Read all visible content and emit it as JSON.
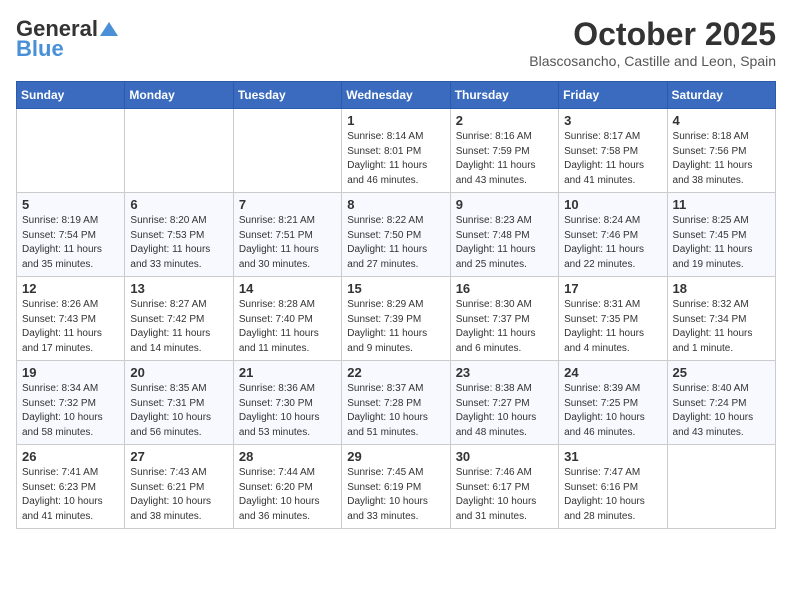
{
  "header": {
    "logo_general": "General",
    "logo_blue": "Blue",
    "month": "October 2025",
    "location": "Blascosancho, Castille and Leon, Spain"
  },
  "weekdays": [
    "Sunday",
    "Monday",
    "Tuesday",
    "Wednesday",
    "Thursday",
    "Friday",
    "Saturday"
  ],
  "weeks": [
    [
      {
        "day": "",
        "info": ""
      },
      {
        "day": "",
        "info": ""
      },
      {
        "day": "",
        "info": ""
      },
      {
        "day": "1",
        "info": "Sunrise: 8:14 AM\nSunset: 8:01 PM\nDaylight: 11 hours and 46 minutes."
      },
      {
        "day": "2",
        "info": "Sunrise: 8:16 AM\nSunset: 7:59 PM\nDaylight: 11 hours and 43 minutes."
      },
      {
        "day": "3",
        "info": "Sunrise: 8:17 AM\nSunset: 7:58 PM\nDaylight: 11 hours and 41 minutes."
      },
      {
        "day": "4",
        "info": "Sunrise: 8:18 AM\nSunset: 7:56 PM\nDaylight: 11 hours and 38 minutes."
      }
    ],
    [
      {
        "day": "5",
        "info": "Sunrise: 8:19 AM\nSunset: 7:54 PM\nDaylight: 11 hours and 35 minutes."
      },
      {
        "day": "6",
        "info": "Sunrise: 8:20 AM\nSunset: 7:53 PM\nDaylight: 11 hours and 33 minutes."
      },
      {
        "day": "7",
        "info": "Sunrise: 8:21 AM\nSunset: 7:51 PM\nDaylight: 11 hours and 30 minutes."
      },
      {
        "day": "8",
        "info": "Sunrise: 8:22 AM\nSunset: 7:50 PM\nDaylight: 11 hours and 27 minutes."
      },
      {
        "day": "9",
        "info": "Sunrise: 8:23 AM\nSunset: 7:48 PM\nDaylight: 11 hours and 25 minutes."
      },
      {
        "day": "10",
        "info": "Sunrise: 8:24 AM\nSunset: 7:46 PM\nDaylight: 11 hours and 22 minutes."
      },
      {
        "day": "11",
        "info": "Sunrise: 8:25 AM\nSunset: 7:45 PM\nDaylight: 11 hours and 19 minutes."
      }
    ],
    [
      {
        "day": "12",
        "info": "Sunrise: 8:26 AM\nSunset: 7:43 PM\nDaylight: 11 hours and 17 minutes."
      },
      {
        "day": "13",
        "info": "Sunrise: 8:27 AM\nSunset: 7:42 PM\nDaylight: 11 hours and 14 minutes."
      },
      {
        "day": "14",
        "info": "Sunrise: 8:28 AM\nSunset: 7:40 PM\nDaylight: 11 hours and 11 minutes."
      },
      {
        "day": "15",
        "info": "Sunrise: 8:29 AM\nSunset: 7:39 PM\nDaylight: 11 hours and 9 minutes."
      },
      {
        "day": "16",
        "info": "Sunrise: 8:30 AM\nSunset: 7:37 PM\nDaylight: 11 hours and 6 minutes."
      },
      {
        "day": "17",
        "info": "Sunrise: 8:31 AM\nSunset: 7:35 PM\nDaylight: 11 hours and 4 minutes."
      },
      {
        "day": "18",
        "info": "Sunrise: 8:32 AM\nSunset: 7:34 PM\nDaylight: 11 hours and 1 minute."
      }
    ],
    [
      {
        "day": "19",
        "info": "Sunrise: 8:34 AM\nSunset: 7:32 PM\nDaylight: 10 hours and 58 minutes."
      },
      {
        "day": "20",
        "info": "Sunrise: 8:35 AM\nSunset: 7:31 PM\nDaylight: 10 hours and 56 minutes."
      },
      {
        "day": "21",
        "info": "Sunrise: 8:36 AM\nSunset: 7:30 PM\nDaylight: 10 hours and 53 minutes."
      },
      {
        "day": "22",
        "info": "Sunrise: 8:37 AM\nSunset: 7:28 PM\nDaylight: 10 hours and 51 minutes."
      },
      {
        "day": "23",
        "info": "Sunrise: 8:38 AM\nSunset: 7:27 PM\nDaylight: 10 hours and 48 minutes."
      },
      {
        "day": "24",
        "info": "Sunrise: 8:39 AM\nSunset: 7:25 PM\nDaylight: 10 hours and 46 minutes."
      },
      {
        "day": "25",
        "info": "Sunrise: 8:40 AM\nSunset: 7:24 PM\nDaylight: 10 hours and 43 minutes."
      }
    ],
    [
      {
        "day": "26",
        "info": "Sunrise: 7:41 AM\nSunset: 6:23 PM\nDaylight: 10 hours and 41 minutes."
      },
      {
        "day": "27",
        "info": "Sunrise: 7:43 AM\nSunset: 6:21 PM\nDaylight: 10 hours and 38 minutes."
      },
      {
        "day": "28",
        "info": "Sunrise: 7:44 AM\nSunset: 6:20 PM\nDaylight: 10 hours and 36 minutes."
      },
      {
        "day": "29",
        "info": "Sunrise: 7:45 AM\nSunset: 6:19 PM\nDaylight: 10 hours and 33 minutes."
      },
      {
        "day": "30",
        "info": "Sunrise: 7:46 AM\nSunset: 6:17 PM\nDaylight: 10 hours and 31 minutes."
      },
      {
        "day": "31",
        "info": "Sunrise: 7:47 AM\nSunset: 6:16 PM\nDaylight: 10 hours and 28 minutes."
      },
      {
        "day": "",
        "info": ""
      }
    ]
  ]
}
